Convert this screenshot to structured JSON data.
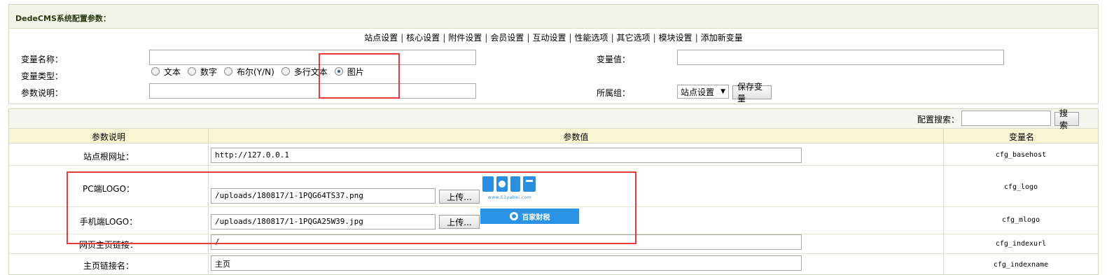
{
  "config_panel": {
    "title": "DedeCMS系统配置参数：",
    "nav_tabs": [
      "站点设置",
      "核心设置",
      "附件设置",
      "会员设置",
      "互动设置",
      "性能选项",
      "其它选项",
      "模块设置",
      "添加新变量"
    ],
    "nav_separator": "|"
  },
  "add_variable_form": {
    "var_name_label": "变量名称：",
    "var_name_value": "",
    "var_value_label": "变量值：",
    "var_value_value": "",
    "var_type_label": "变量类型：",
    "type_options": [
      {
        "label": "文本",
        "checked": false
      },
      {
        "label": "数字",
        "checked": false
      },
      {
        "label": "布尔(Y/N)",
        "checked": false
      },
      {
        "label": "多行文本",
        "checked": false
      },
      {
        "label": "图片",
        "checked": true
      }
    ],
    "desc_label": "参数说明：",
    "desc_value": "",
    "group_label": "所属组：",
    "group_selected": "站点设置",
    "save_button": "保存变量"
  },
  "config_table": {
    "search_label": "配置搜索：",
    "search_value": "",
    "search_button": "搜索",
    "columns": [
      "参数说明",
      "参数值",
      "变量名"
    ],
    "rows": [
      {
        "desc": "站点根网址：",
        "value": "http://127.0.0.1",
        "var": "cfg_basehost"
      },
      {
        "desc": "PC端LOGO：",
        "value": "/uploads/180817/1-1PQG64TS37.png",
        "upload_button": "上传...",
        "var": "cfg_logo"
      },
      {
        "desc": "手机端LOGO：",
        "value": "/uploads/180817/1-1PQGA25W39.jpg",
        "upload_button": "上传...",
        "var": "cfg_mlogo"
      },
      {
        "desc": "网页主页链接：",
        "value": "/",
        "var": "cfg_indexurl"
      },
      {
        "desc": "主页链接名：",
        "value": "主页",
        "var": "cfg_indexname"
      }
    ]
  },
  "watermark": {
    "url_text": "www.51yabei.com",
    "banner_text": "百家财税"
  },
  "colors": {
    "highlight_box": "#e8393c",
    "header_bg": "#f7f8d3",
    "watermark_blue": "#2b93e5"
  }
}
